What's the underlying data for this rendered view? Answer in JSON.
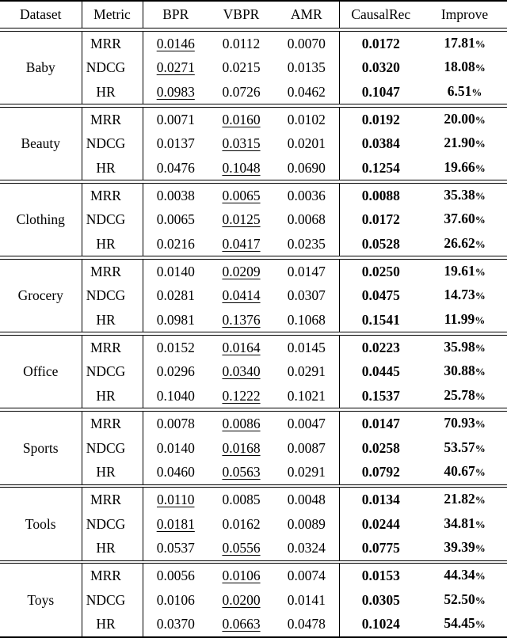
{
  "table": {
    "columns": [
      {
        "key": "dataset",
        "label": "Dataset"
      },
      {
        "key": "metric",
        "label": "Metric"
      },
      {
        "key": "bpr",
        "label": "BPR"
      },
      {
        "key": "vbpr",
        "label": "VBPR"
      },
      {
        "key": "amr",
        "label": "AMR"
      },
      {
        "key": "causalrec",
        "label": "CausalRec"
      },
      {
        "key": "improve",
        "label": "Improve"
      }
    ],
    "percent_symbol": "%",
    "groups": [
      {
        "dataset": "Baby",
        "rows": [
          {
            "metric": "MRR",
            "bpr": "0.0146",
            "bpr_underline": true,
            "vbpr": "0.0112",
            "vbpr_underline": false,
            "amr": "0.0070",
            "causalrec": "0.0172",
            "improve": "17.81"
          },
          {
            "metric": "NDCG",
            "bpr": "0.0271",
            "bpr_underline": true,
            "vbpr": "0.0215",
            "vbpr_underline": false,
            "amr": "0.0135",
            "causalrec": "0.0320",
            "improve": "18.08"
          },
          {
            "metric": "HR",
            "bpr": "0.0983",
            "bpr_underline": true,
            "vbpr": "0.0726",
            "vbpr_underline": false,
            "amr": "0.0462",
            "causalrec": "0.1047",
            "improve": "6.51"
          }
        ]
      },
      {
        "dataset": "Beauty",
        "rows": [
          {
            "metric": "MRR",
            "bpr": "0.0071",
            "bpr_underline": false,
            "vbpr": "0.0160",
            "vbpr_underline": true,
            "amr": "0.0102",
            "causalrec": "0.0192",
            "improve": "20.00"
          },
          {
            "metric": "NDCG",
            "bpr": "0.0137",
            "bpr_underline": false,
            "vbpr": "0.0315",
            "vbpr_underline": true,
            "amr": "0.0201",
            "causalrec": "0.0384",
            "improve": "21.90"
          },
          {
            "metric": "HR",
            "bpr": "0.0476",
            "bpr_underline": false,
            "vbpr": "0.1048",
            "vbpr_underline": true,
            "amr": "0.0690",
            "causalrec": "0.1254",
            "improve": "19.66"
          }
        ]
      },
      {
        "dataset": "Clothing",
        "rows": [
          {
            "metric": "MRR",
            "bpr": "0.0038",
            "bpr_underline": false,
            "vbpr": "0.0065",
            "vbpr_underline": true,
            "amr": "0.0036",
            "causalrec": "0.0088",
            "improve": "35.38"
          },
          {
            "metric": "NDCG",
            "bpr": "0.0065",
            "bpr_underline": false,
            "vbpr": "0.0125",
            "vbpr_underline": true,
            "amr": "0.0068",
            "causalrec": "0.0172",
            "improve": "37.60"
          },
          {
            "metric": "HR",
            "bpr": "0.0216",
            "bpr_underline": false,
            "vbpr": "0.0417",
            "vbpr_underline": true,
            "amr": "0.0235",
            "causalrec": "0.0528",
            "improve": "26.62"
          }
        ]
      },
      {
        "dataset": "Grocery",
        "rows": [
          {
            "metric": "MRR",
            "bpr": "0.0140",
            "bpr_underline": false,
            "vbpr": "0.0209",
            "vbpr_underline": true,
            "amr": "0.0147",
            "causalrec": "0.0250",
            "improve": "19.61"
          },
          {
            "metric": "NDCG",
            "bpr": "0.0281",
            "bpr_underline": false,
            "vbpr": "0.0414",
            "vbpr_underline": true,
            "amr": "0.0307",
            "causalrec": "0.0475",
            "improve": "14.73"
          },
          {
            "metric": "HR",
            "bpr": "0.0981",
            "bpr_underline": false,
            "vbpr": "0.1376",
            "vbpr_underline": true,
            "amr": "0.1068",
            "causalrec": "0.1541",
            "improve": "11.99"
          }
        ]
      },
      {
        "dataset": "Office",
        "rows": [
          {
            "metric": "MRR",
            "bpr": "0.0152",
            "bpr_underline": false,
            "vbpr": "0.0164",
            "vbpr_underline": true,
            "amr": "0.0145",
            "causalrec": "0.0223",
            "improve": "35.98"
          },
          {
            "metric": "NDCG",
            "bpr": "0.0296",
            "bpr_underline": false,
            "vbpr": "0.0340",
            "vbpr_underline": true,
            "amr": "0.0291",
            "causalrec": "0.0445",
            "improve": "30.88"
          },
          {
            "metric": "HR",
            "bpr": "0.1040",
            "bpr_underline": false,
            "vbpr": "0.1222",
            "vbpr_underline": true,
            "amr": "0.1021",
            "causalrec": "0.1537",
            "improve": "25.78"
          }
        ]
      },
      {
        "dataset": "Sports",
        "rows": [
          {
            "metric": "MRR",
            "bpr": "0.0078",
            "bpr_underline": false,
            "vbpr": "0.0086",
            "vbpr_underline": true,
            "amr": "0.0047",
            "causalrec": "0.0147",
            "improve": "70.93"
          },
          {
            "metric": "NDCG",
            "bpr": "0.0140",
            "bpr_underline": false,
            "vbpr": "0.0168",
            "vbpr_underline": true,
            "amr": "0.0087",
            "causalrec": "0.0258",
            "improve": "53.57"
          },
          {
            "metric": "HR",
            "bpr": "0.0460",
            "bpr_underline": false,
            "vbpr": "0.0563",
            "vbpr_underline": true,
            "amr": "0.0291",
            "causalrec": "0.0792",
            "improve": "40.67"
          }
        ]
      },
      {
        "dataset": "Tools",
        "rows": [
          {
            "metric": "MRR",
            "bpr": "0.0110",
            "bpr_underline": true,
            "vbpr": "0.0085",
            "vbpr_underline": false,
            "amr": "0.0048",
            "causalrec": "0.0134",
            "improve": "21.82"
          },
          {
            "metric": "NDCG",
            "bpr": "0.0181",
            "bpr_underline": true,
            "vbpr": "0.0162",
            "vbpr_underline": false,
            "amr": "0.0089",
            "causalrec": "0.0244",
            "improve": "34.81"
          },
          {
            "metric": "HR",
            "bpr": "0.0537",
            "bpr_underline": false,
            "vbpr": "0.0556",
            "vbpr_underline": true,
            "amr": "0.0324",
            "causalrec": "0.0775",
            "improve": "39.39"
          }
        ]
      },
      {
        "dataset": "Toys",
        "rows": [
          {
            "metric": "MRR",
            "bpr": "0.0056",
            "bpr_underline": false,
            "vbpr": "0.0106",
            "vbpr_underline": true,
            "amr": "0.0074",
            "causalrec": "0.0153",
            "improve": "44.34"
          },
          {
            "metric": "NDCG",
            "bpr": "0.0106",
            "bpr_underline": false,
            "vbpr": "0.0200",
            "vbpr_underline": true,
            "amr": "0.0141",
            "causalrec": "0.0305",
            "improve": "52.50"
          },
          {
            "metric": "HR",
            "bpr": "0.0370",
            "bpr_underline": false,
            "vbpr": "0.0663",
            "vbpr_underline": true,
            "amr": "0.0478",
            "causalrec": "0.1024",
            "improve": "54.45"
          }
        ]
      }
    ]
  }
}
